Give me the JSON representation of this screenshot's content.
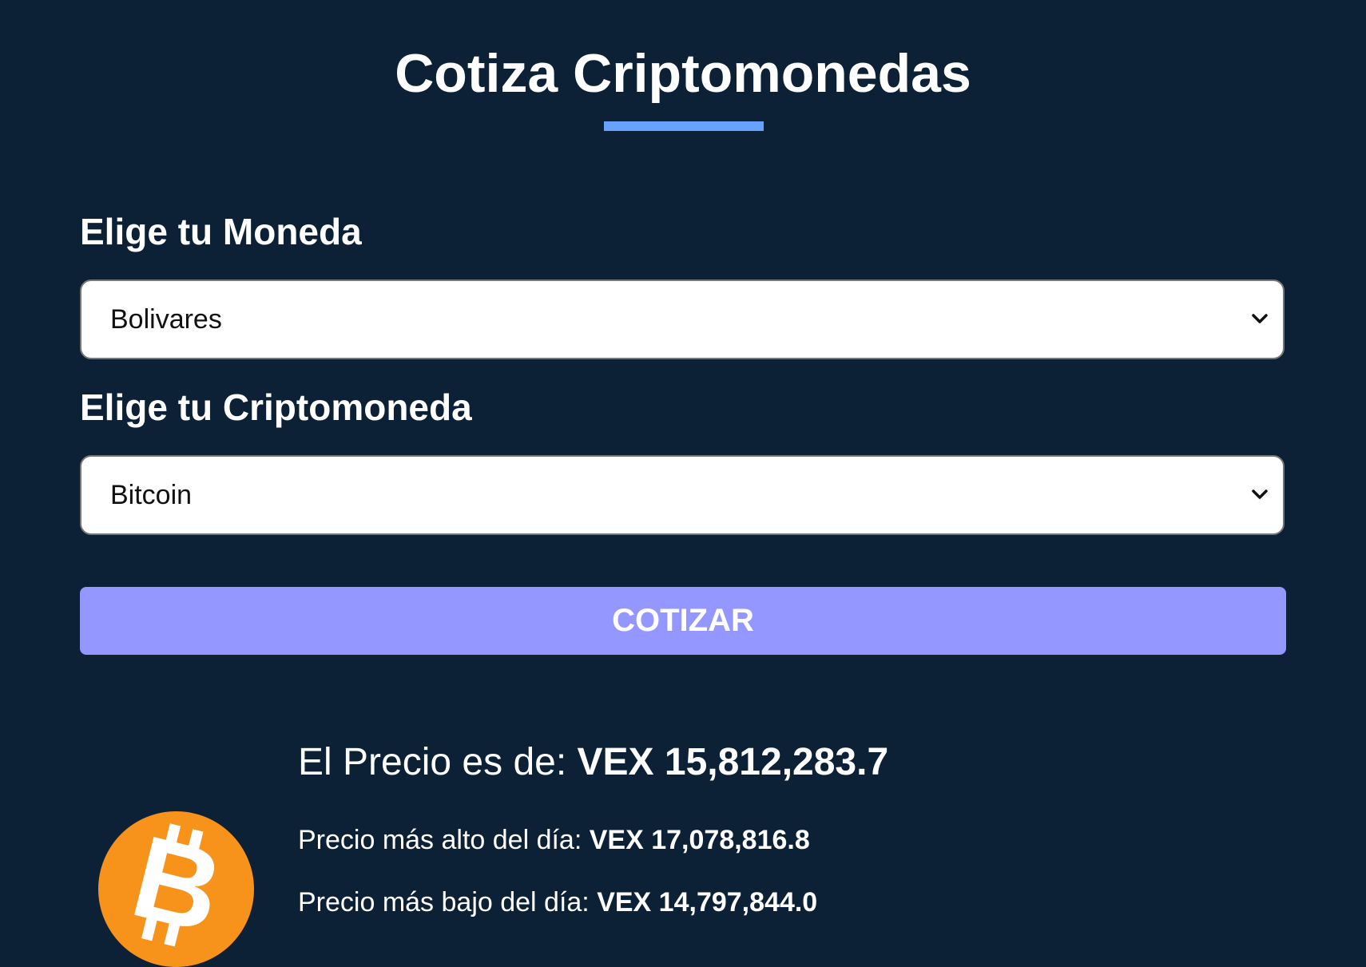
{
  "header": {
    "title": "Cotiza Criptomonedas",
    "accent_color": "#66a2fe"
  },
  "form": {
    "currency_label": "Elige tu Moneda",
    "currency_selected": "Bolivares",
    "crypto_label": "Elige tu Criptomoneda",
    "crypto_selected": "Bitcoin",
    "submit_label": "COTIZAR",
    "submit_color": "#9497ff"
  },
  "result": {
    "price_label": "El Precio es de: ",
    "price_value": "VEX 15,812,283.7",
    "high_label": "Precio más alto del día: ",
    "high_value": "VEX 17,078,816.8",
    "low_label": "Precio más bajo del día: ",
    "low_value": "VEX 14,797,844.0",
    "coin_icon": "bitcoin-icon",
    "coin_color": "#f7931a"
  },
  "theme": {
    "background": "#0d2136"
  }
}
